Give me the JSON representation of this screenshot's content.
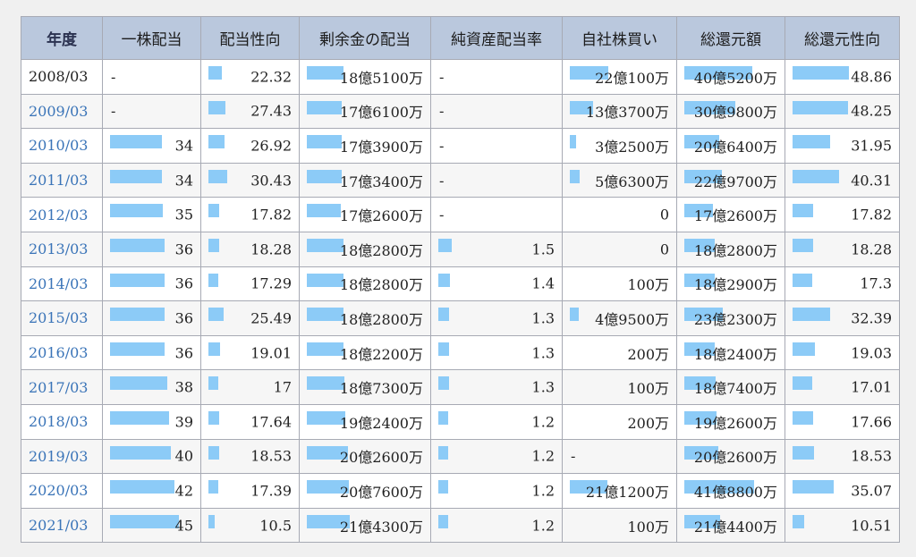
{
  "table": {
    "columns": [
      "年度",
      "一株配当",
      "配当性向",
      "剰余金の配当",
      "純資産配当率",
      "自社株買い",
      "総還元額",
      "総還元性向"
    ],
    "bar_color": "#8ccbf7",
    "link_color": "#3a74b8",
    "header_bg": "#bac8dd",
    "rows": [
      {
        "year": "2008/03",
        "year_link": false,
        "dividend_per_share": "-",
        "payout_ratio": "22.32",
        "surplus_dividend": "18億5100万",
        "net_asset_dividend_rate": "-",
        "buyback": "22億100万",
        "total_return": "40億5200万",
        "total_return_ratio": "48.86"
      },
      {
        "year": "2009/03",
        "year_link": true,
        "dividend_per_share": "-",
        "payout_ratio": "27.43",
        "surplus_dividend": "17億6100万",
        "net_asset_dividend_rate": "-",
        "buyback": "13億3700万",
        "total_return": "30億9800万",
        "total_return_ratio": "48.25"
      },
      {
        "year": "2010/03",
        "year_link": true,
        "dividend_per_share": "34",
        "payout_ratio": "26.92",
        "surplus_dividend": "17億3900万",
        "net_asset_dividend_rate": "-",
        "buyback": "3億2500万",
        "total_return": "20億6400万",
        "total_return_ratio": "31.95"
      },
      {
        "year": "2011/03",
        "year_link": true,
        "dividend_per_share": "34",
        "payout_ratio": "30.43",
        "surplus_dividend": "17億3400万",
        "net_asset_dividend_rate": "-",
        "buyback": "5億6300万",
        "total_return": "22億9700万",
        "total_return_ratio": "40.31"
      },
      {
        "year": "2012/03",
        "year_link": true,
        "dividend_per_share": "35",
        "payout_ratio": "17.82",
        "surplus_dividend": "17億2600万",
        "net_asset_dividend_rate": "-",
        "buyback": "0",
        "total_return": "17億2600万",
        "total_return_ratio": "17.82"
      },
      {
        "year": "2013/03",
        "year_link": true,
        "dividend_per_share": "36",
        "payout_ratio": "18.28",
        "surplus_dividend": "18億2800万",
        "net_asset_dividend_rate": "1.5",
        "buyback": "0",
        "total_return": "18億2800万",
        "total_return_ratio": "18.28"
      },
      {
        "year": "2014/03",
        "year_link": true,
        "dividend_per_share": "36",
        "payout_ratio": "17.29",
        "surplus_dividend": "18億2800万",
        "net_asset_dividend_rate": "1.4",
        "buyback": "100万",
        "total_return": "18億2900万",
        "total_return_ratio": "17.3"
      },
      {
        "year": "2015/03",
        "year_link": true,
        "dividend_per_share": "36",
        "payout_ratio": "25.49",
        "surplus_dividend": "18億2800万",
        "net_asset_dividend_rate": "1.3",
        "buyback": "4億9500万",
        "total_return": "23億2300万",
        "total_return_ratio": "32.39"
      },
      {
        "year": "2016/03",
        "year_link": true,
        "dividend_per_share": "36",
        "payout_ratio": "19.01",
        "surplus_dividend": "18億2200万",
        "net_asset_dividend_rate": "1.3",
        "buyback": "200万",
        "total_return": "18億2400万",
        "total_return_ratio": "19.03"
      },
      {
        "year": "2017/03",
        "year_link": true,
        "dividend_per_share": "38",
        "payout_ratio": "17",
        "surplus_dividend": "18億7300万",
        "net_asset_dividend_rate": "1.3",
        "buyback": "100万",
        "total_return": "18億7400万",
        "total_return_ratio": "17.01"
      },
      {
        "year": "2018/03",
        "year_link": true,
        "dividend_per_share": "39",
        "payout_ratio": "17.64",
        "surplus_dividend": "19億2400万",
        "net_asset_dividend_rate": "1.2",
        "buyback": "200万",
        "total_return": "19億2600万",
        "total_return_ratio": "17.66"
      },
      {
        "year": "2019/03",
        "year_link": true,
        "dividend_per_share": "40",
        "payout_ratio": "18.53",
        "surplus_dividend": "20億2600万",
        "net_asset_dividend_rate": "1.2",
        "buyback": "-",
        "total_return": "20億2600万",
        "total_return_ratio": "18.53"
      },
      {
        "year": "2020/03",
        "year_link": true,
        "dividend_per_share": "42",
        "payout_ratio": "17.39",
        "surplus_dividend": "20億7600万",
        "net_asset_dividend_rate": "1.2",
        "buyback": "21億1200万",
        "total_return": "41億8800万",
        "total_return_ratio": "35.07"
      },
      {
        "year": "2021/03",
        "year_link": true,
        "dividend_per_share": "45",
        "payout_ratio": "10.5",
        "surplus_dividend": "21億4300万",
        "net_asset_dividend_rate": "1.2",
        "buyback": "100万",
        "total_return": "21億4400万",
        "total_return_ratio": "10.51"
      }
    ],
    "bar_levels": {
      "dividend_per_share": [
        0,
        0,
        0.81,
        0.81,
        0.83,
        0.86,
        0.86,
        0.86,
        0.86,
        0.9,
        0.93,
        0.95,
        1.0,
        1.07
      ],
      "payout_ratio": [
        0.21,
        0.26,
        0.25,
        0.29,
        0.17,
        0.17,
        0.16,
        0.24,
        0.18,
        0.16,
        0.17,
        0.17,
        0.16,
        0.1
      ],
      "surplus_dividend": [
        0.43,
        0.41,
        0.41,
        0.41,
        0.4,
        0.43,
        0.43,
        0.43,
        0.43,
        0.44,
        0.45,
        0.48,
        0.49,
        0.5
      ],
      "net_asset_dividend_rate": [
        0,
        0,
        0,
        0,
        0,
        0.16,
        0.14,
        0.13,
        0.13,
        0.13,
        0.12,
        0.12,
        0.12,
        0.12
      ],
      "buyback": [
        0.52,
        0.31,
        0.08,
        0.13,
        0,
        0,
        0,
        0.12,
        0,
        0,
        0,
        0,
        0.5,
        0
      ],
      "total_return": [
        0.96,
        0.73,
        0.49,
        0.54,
        0.41,
        0.43,
        0.43,
        0.55,
        0.43,
        0.44,
        0.46,
        0.48,
        0.99,
        0.51
      ],
      "total_return_ratio": [
        0.76,
        0.75,
        0.5,
        0.63,
        0.28,
        0.28,
        0.27,
        0.51,
        0.3,
        0.26,
        0.28,
        0.29,
        0.55,
        0.16
      ]
    }
  }
}
